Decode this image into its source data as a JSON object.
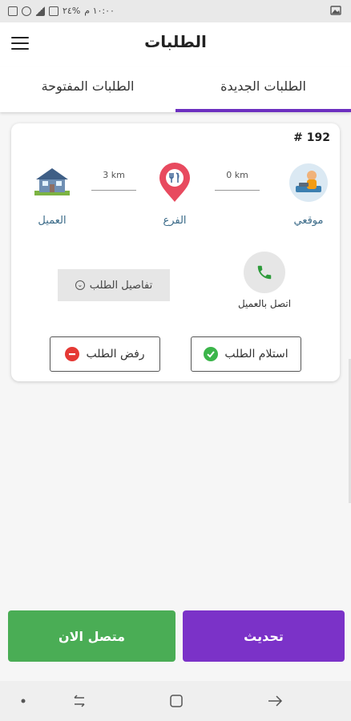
{
  "status_bar": {
    "time": "١٠:٠٠ م",
    "battery": "%٢٤",
    "icons": [
      "battery-icon",
      "signal-icon",
      "wifi-icon",
      "notification-icon",
      "image-icon"
    ]
  },
  "header": {
    "title": "الطلبات",
    "menu_icon": "hamburger-icon"
  },
  "tabs": [
    {
      "label": "الطلبات الجديدة",
      "active": true
    },
    {
      "label": "الطلبات المفتوحة",
      "active": false
    }
  ],
  "order": {
    "number": "# 192",
    "stops": {
      "me": {
        "label": "موقعي",
        "icon": "my-location-avatar-icon"
      },
      "branch": {
        "label": "الفرع",
        "icon": "branch-pin-icon"
      },
      "customer": {
        "label": "العميل",
        "icon": "customer-house-icon"
      }
    },
    "distance_me_branch": "0 km",
    "distance_branch_customer": "3 km",
    "call_label": "اتصل بالعميل",
    "details_label": "تفاصيل الطلب",
    "accept_label": "استلام الطلب",
    "reject_label": "رفض الطلب"
  },
  "bottom": {
    "refresh_label": "تحديث",
    "online_label": "متصل الان"
  },
  "colors": {
    "accent": "#6c2fc0",
    "refresh": "#7b32c8",
    "online": "#4aad55",
    "accept_check": "#3bb54a",
    "reject_icon": "#e53935",
    "call_icon": "#2e9b3b",
    "pin": "#e84a5f"
  }
}
